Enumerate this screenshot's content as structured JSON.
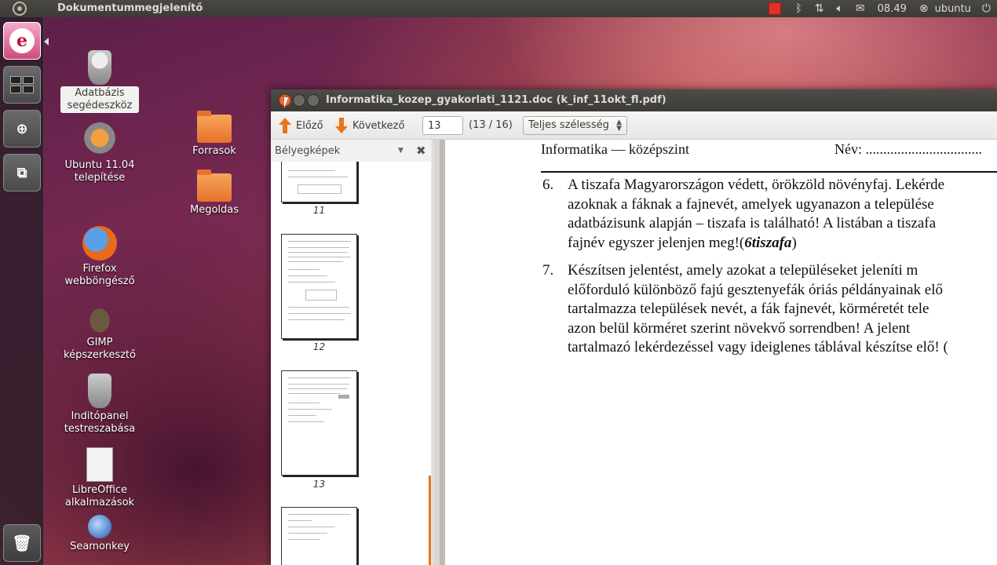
{
  "top_panel": {
    "app_title": "Dokumentummegjelenítő",
    "clock": "08.49",
    "user": "ubuntu"
  },
  "desktop_icons": [
    {
      "label": "Adatbázis segédeszköz",
      "icon": "database-tool-icon"
    },
    {
      "label": "Ubuntu 11.04 telepítése",
      "icon": "installer-icon"
    },
    {
      "label": "Firefox webböngésző",
      "icon": "firefox-icon"
    },
    {
      "label": "GIMP képszerkesztő",
      "icon": "gimp-icon"
    },
    {
      "label": "Inditópanel testreszabása",
      "icon": "panel-customize-icon"
    },
    {
      "label": "LibreOffice alkalmazások",
      "icon": "libreoffice-icon"
    },
    {
      "label": "Seamonkey",
      "icon": "seamonkey-icon"
    },
    {
      "label": "Forrasok",
      "icon": "folder-icon"
    },
    {
      "label": "Megoldas",
      "icon": "folder-icon"
    }
  ],
  "window": {
    "title": "Informatika_kozep_gyakorlati_1121.doc (k_inf_11okt_fl.pdf)"
  },
  "toolbar": {
    "prev_label": "Előző",
    "next_label": "Következő",
    "page_value": "13",
    "page_count": "(13 / 16)",
    "zoom_value": "Teljes szélesség"
  },
  "sidebar": {
    "header": "Bélyegképek",
    "thumbnails": [
      "11",
      "12",
      "13"
    ]
  },
  "document": {
    "header_left": "Informatika — középszint",
    "header_right": "Név: .................................",
    "items": [
      {
        "number": "6.",
        "lines": [
          "A tiszafa Magyarországon védett, örökzöld növényfaj. Lekérde",
          "azoknak a fáknak a fajnevét, amelyek ugyanazon a települése",
          "adatbázisunk alapján – tiszafa is található! A listában a tiszafa",
          "fajnév egyszer jelenjen meg!("
        ],
        "emphasis": "6tiszafa",
        "tail": ")"
      },
      {
        "number": "7.",
        "lines": [
          "Készítsen jelentést, amely azokat a településeket jeleníti m",
          "előforduló különböző fajú gesztenyefák óriás példányainak elő",
          "tartalmazza települések nevét, a fák fajnevét, körméretét tele",
          "azon belül körméret szerint növekvő sorrendben! A jelent",
          "tartalmazó lekérdezéssel vagy ideiglenes táblával készítse elő! ("
        ]
      }
    ]
  },
  "colors": {
    "accent": "#e8751a",
    "close_button": "#dd4814",
    "panel": "#3c3b37"
  }
}
